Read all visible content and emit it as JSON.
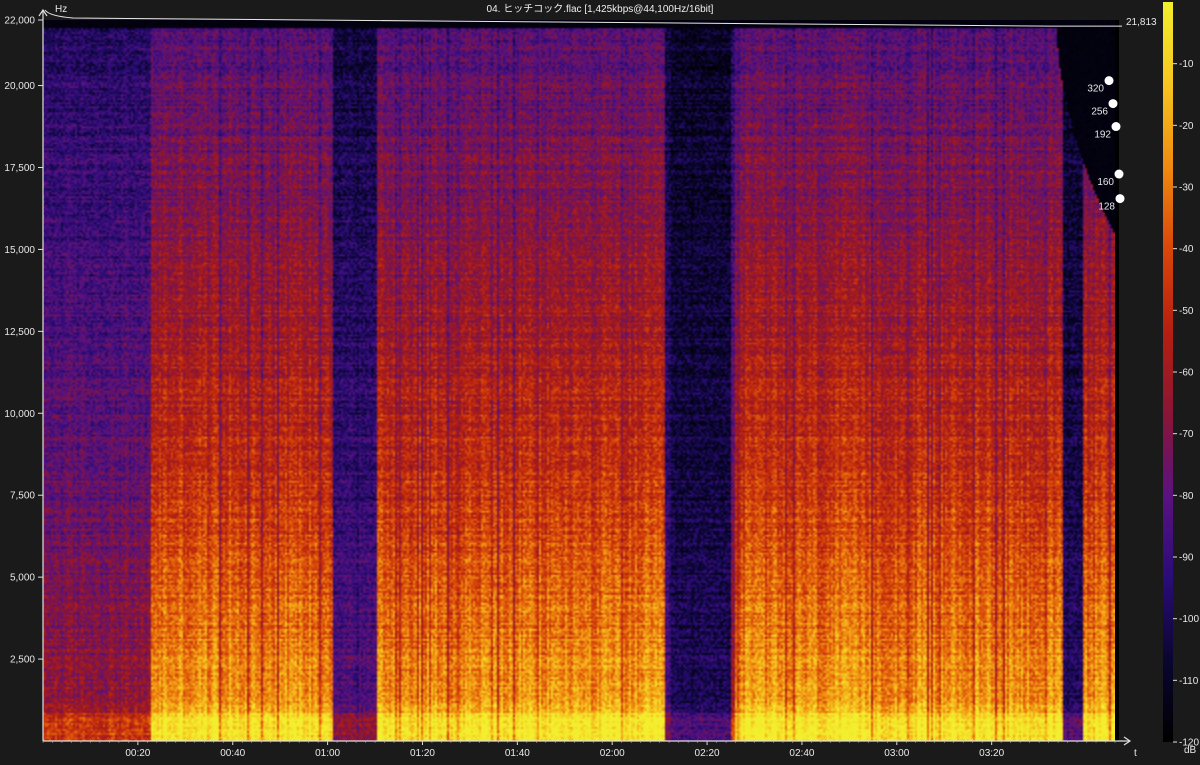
{
  "chart_data": {
    "type": "heatmap",
    "title": "04. ヒッチコック.flac [1,425kbps@44,100Hz/16bit]",
    "ylabel": "Hz",
    "xlabel": "t",
    "ylim": [
      0,
      22000
    ],
    "y_ticks": [
      22000,
      20000,
      17500,
      15000,
      12500,
      10000,
      7500,
      5000,
      2500
    ],
    "y_tick_labels": [
      "22,000",
      "20,000",
      "17,500",
      "15,000",
      "12,500",
      "10,000",
      "7,500",
      "5,000",
      "2,500"
    ],
    "x_range_seconds": [
      0,
      226
    ],
    "x_ticks_seconds": [
      20,
      40,
      60,
      80,
      100,
      120,
      140,
      160,
      180,
      200
    ],
    "x_tick_labels": [
      "00:20",
      "00:40",
      "01:00",
      "01:20",
      "01:40",
      "02:00",
      "02:20",
      "02:40",
      "03:00",
      "03:20"
    ],
    "cutoff_frequency_label": "21,813",
    "cutoff_frequency_hz": 21813,
    "bitrate_markers": [
      {
        "label": "320",
        "hz": 20150
      },
      {
        "label": "256",
        "hz": 19450
      },
      {
        "label": "192",
        "hz": 18750
      },
      {
        "label": "160",
        "hz": 17300
      },
      {
        "label": "128",
        "hz": 16550
      }
    ],
    "colorbar": {
      "label": "dB",
      "range": [
        -120,
        0
      ],
      "ticks": [
        -10,
        -20,
        -30,
        -40,
        -50,
        -60,
        -70,
        -80,
        -90,
        -100,
        -110,
        -120
      ],
      "tick_labels": [
        "-10",
        "-20",
        "-30",
        "-40",
        "-50",
        "-60",
        "-70",
        "-80",
        "-90",
        "-100",
        "-110",
        "-120"
      ],
      "colors": [
        "#000000",
        "#0a0630",
        "#2a0c78",
        "#5a1280",
        "#8a1535",
        "#b51f10",
        "#d8470a",
        "#ef8a10",
        "#f6c520",
        "#f3ef2e"
      ]
    }
  }
}
